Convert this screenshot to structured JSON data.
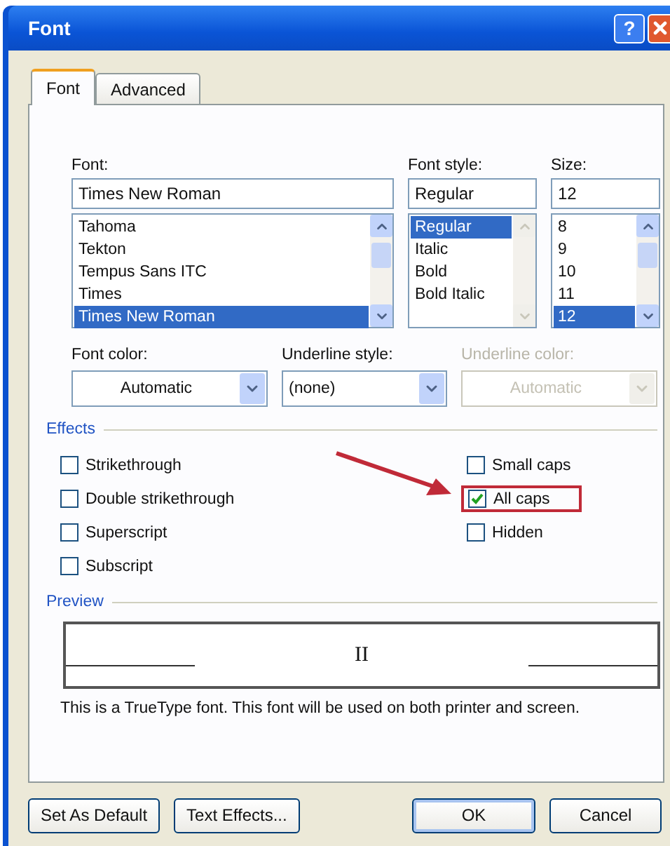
{
  "window": {
    "title": "Font",
    "help_button": "?"
  },
  "tabs": [
    {
      "label": "Font",
      "selected": true
    },
    {
      "label": "Advanced",
      "selected": false
    }
  ],
  "font": {
    "label": "Font:",
    "value": "Times New Roman",
    "items": [
      {
        "label": "Tahoma",
        "selected": false
      },
      {
        "label": "Tekton",
        "selected": false
      },
      {
        "label": "Tempus Sans ITC",
        "selected": false
      },
      {
        "label": "Times",
        "selected": false
      },
      {
        "label": "Times New Roman",
        "selected": true
      }
    ]
  },
  "font_style": {
    "label": "Font style:",
    "value": "Regular",
    "items": [
      {
        "label": "Regular",
        "selected": true
      },
      {
        "label": "Italic",
        "selected": false
      },
      {
        "label": "Bold",
        "selected": false
      },
      {
        "label": "Bold Italic",
        "selected": false
      }
    ]
  },
  "size": {
    "label": "Size:",
    "value": "12",
    "items": [
      {
        "label": "8",
        "selected": false
      },
      {
        "label": "9",
        "selected": false
      },
      {
        "label": "10",
        "selected": false
      },
      {
        "label": "11",
        "selected": false
      },
      {
        "label": "12",
        "selected": true
      }
    ]
  },
  "combos": [
    {
      "label": "Font color:",
      "value": "Automatic",
      "disabled": false,
      "kind": "color"
    },
    {
      "label": "Underline style:",
      "value": "(none)",
      "disabled": false,
      "kind": "list"
    },
    {
      "label": "Underline color:",
      "value": "Automatic",
      "disabled": true,
      "kind": "color"
    }
  ],
  "effects": {
    "title": "Effects",
    "columns": [
      [
        {
          "label": "Strikethrough",
          "checked": false
        },
        {
          "label": "Double strikethrough",
          "checked": false
        },
        {
          "label": "Superscript",
          "checked": false
        },
        {
          "label": "Subscript",
          "checked": false
        }
      ],
      [
        {
          "label": "Small caps",
          "checked": false
        },
        {
          "label": "All caps",
          "checked": true,
          "highlighted": true
        },
        {
          "label": "Hidden",
          "checked": false
        }
      ]
    ]
  },
  "preview": {
    "title": "Preview",
    "sample": "II",
    "note": "This is a TrueType font. This font will be used on both printer and screen."
  },
  "buttons": [
    {
      "label": "Set As Default",
      "kind": "secondary"
    },
    {
      "label": "Text Effects...",
      "kind": "secondary"
    },
    {
      "label": "OK",
      "kind": "default"
    },
    {
      "label": "Cancel",
      "kind": "primary"
    }
  ]
}
